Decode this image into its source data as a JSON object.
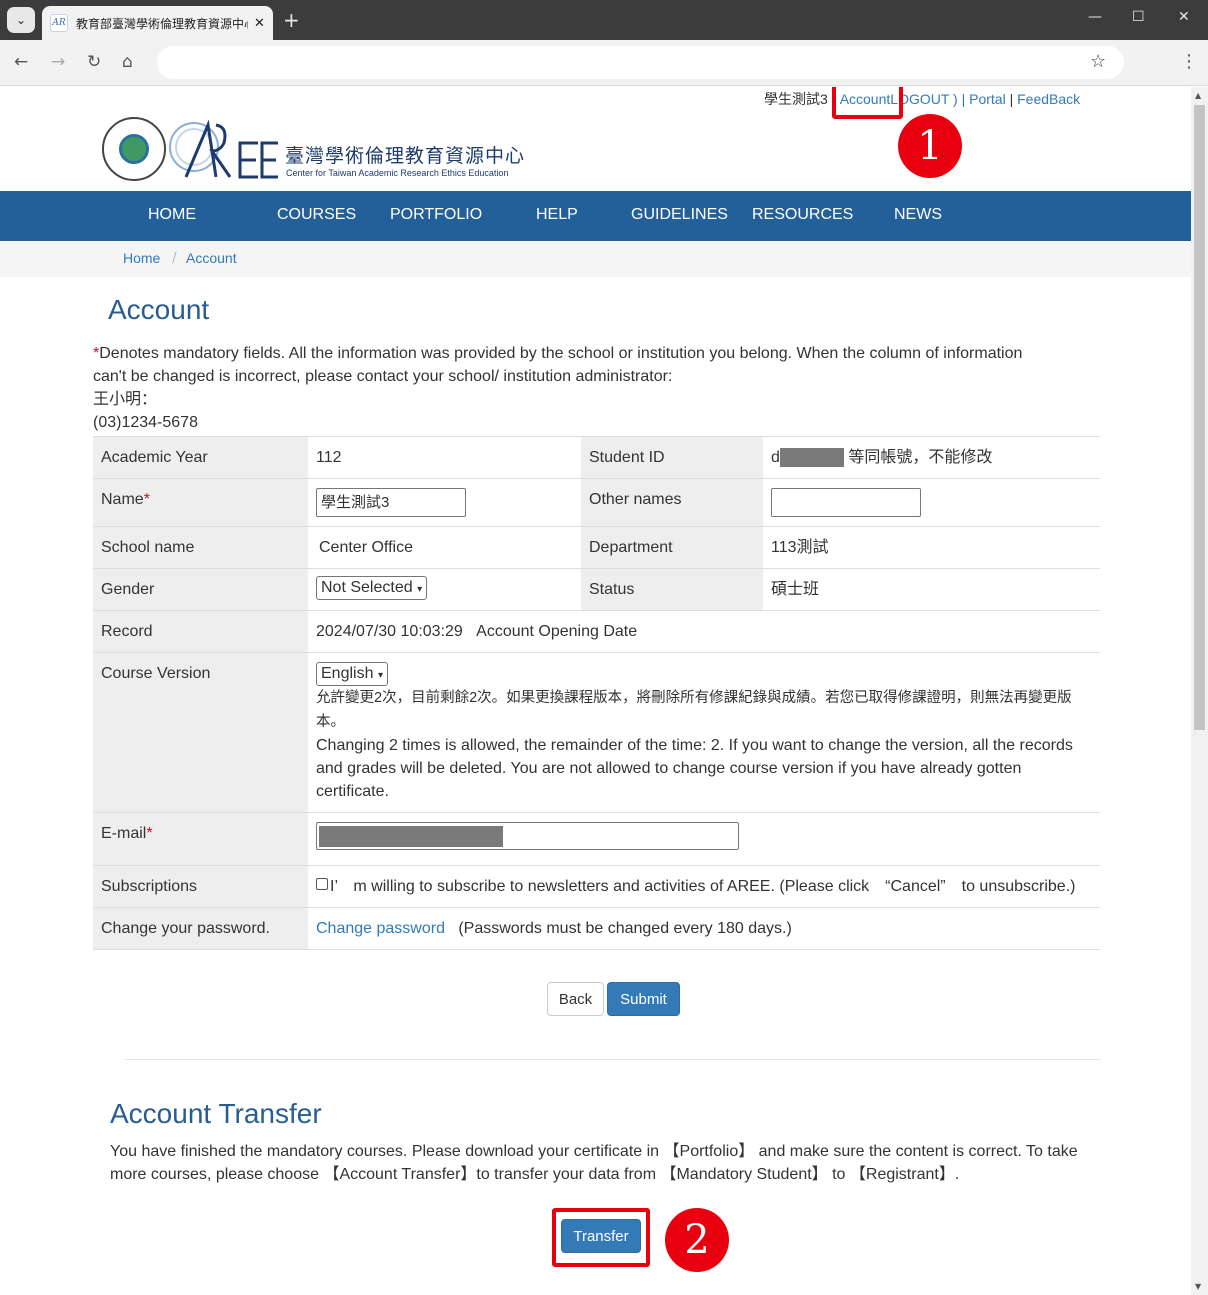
{
  "browser": {
    "tab_title": "教育部臺灣學術倫理教育資源中心",
    "favicon_text": "AR",
    "new_tab": "+",
    "menu_glyph": "⌄",
    "close_glyph": "✕",
    "minimize_glyph": "—",
    "maximize_glyph": "☐",
    "window_close_glyph": "✕",
    "back_glyph": "←",
    "forward_glyph": "→",
    "reload_glyph": "↻",
    "home_glyph": "⌂",
    "star_glyph": "☆",
    "kebab_glyph": "⋮"
  },
  "userbar": {
    "username": "學生測試3",
    "account_link": "Account",
    "logout_text": "LOGOUT ) |",
    "portal_link": "Portal",
    "sep": "|",
    "feedback_link": "FeedBack"
  },
  "annotations": {
    "marker_1": "1",
    "marker_2": "2"
  },
  "logo": {
    "name_cn": "臺灣學術倫理教育資源中心",
    "name_en": "Center for Taiwan Academic Research Ethics Education"
  },
  "nav": {
    "home": "HOME",
    "courses": "COURSES",
    "portfolio": "PORTFOLIO",
    "help": "HELP",
    "guidelines": "GUIDELINES",
    "resources": "RESOURCES",
    "news": "NEWS"
  },
  "breadcrumb": {
    "home": "Home",
    "sep": "/",
    "current": "Account"
  },
  "account": {
    "title": "Account",
    "req_mark": "*",
    "notice": "Denotes mandatory fields. All the information was provided by the school or institution you belong. When the column of information can't be changed is incorrect, please contact your school/ institution administrator:",
    "contact_name": "王小明：",
    "contact_phone": "(03)1234-5678"
  },
  "form": {
    "academic_year_label": "Academic Year",
    "academic_year_value": "112",
    "student_id_label": "Student ID",
    "student_id_prefix": "d",
    "student_id_note": "等同帳號，不能修改",
    "name_label": "Name",
    "name_value": "學生測試3",
    "other_names_label": "Other names",
    "other_names_value": "",
    "school_label": "School name",
    "school_value": "Center Office",
    "department_label": "Department",
    "department_value": "113測試",
    "gender_label": "Gender",
    "gender_value": "Not Selected",
    "status_label": "Status",
    "status_value": "碩士班",
    "record_label": "Record",
    "record_datetime": "2024/07/30 10:03:29",
    "record_desc": "Account Opening Date",
    "course_version_label": "Course Version",
    "course_version_value": "English",
    "course_version_note_cn": "允許變更2次，目前剩餘2次。如果更換課程版本，將刪除所有修課紀錄與成績。若您已取得修課證明，則無法再變更版本。",
    "course_version_note_en": "Changing 2 times is allowed, the remainder of the time: 2. If you want to change the version, all the records and grades will be deleted. You are not allowed to change course version if you have already gotten certificate.",
    "email_label": "E-mail",
    "subscriptions_label": "Subscriptions",
    "subscriptions_text": "I’　m willing to subscribe to newsletters and activities of AREE. (Please click　“Cancel”　to unsubscribe.)",
    "password_label": "Change your password.",
    "password_link": "Change password",
    "password_note": "(Passwords must be changed every 180 days.)"
  },
  "buttons": {
    "back": "Back",
    "submit": "Submit",
    "transfer": "Transfer"
  },
  "transfer": {
    "title": "Account Transfer",
    "text": "You have finished the mandatory courses. Please download your certificate in 【Portfolio】 and make sure the content is correct. To take more courses, please choose 【Account Transfer】to transfer your data from 【Mandatory Student】 to 【Registrant】."
  },
  "colors": {
    "nav_bg": "#23609a",
    "link": "#337ab7",
    "primary_button": "#337ab7",
    "highlight_red": "#e8000f",
    "title_blue": "#2a5d8f"
  }
}
